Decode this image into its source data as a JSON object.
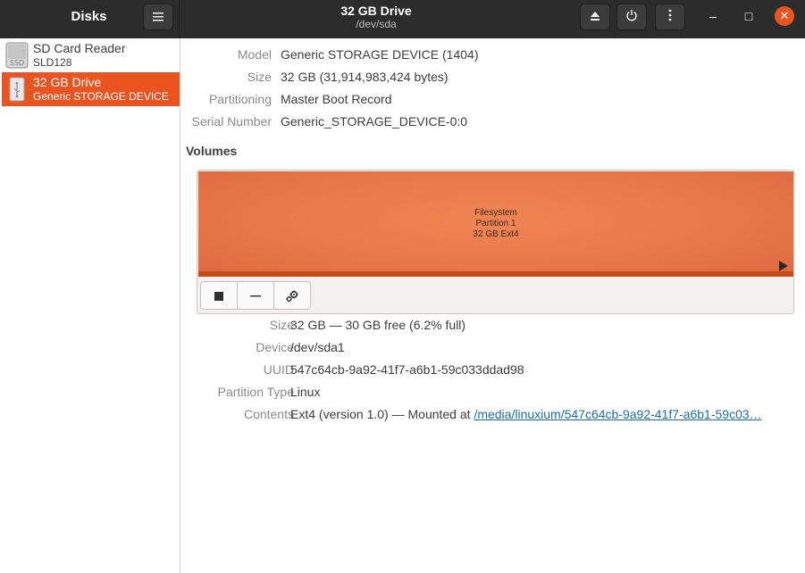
{
  "app": {
    "title": "Disks",
    "menu_icon": "hamburger-menu-icon"
  },
  "header": {
    "drive_title": "32 GB Drive",
    "drive_subtitle": "/dev/sda",
    "eject_icon": "eject-icon",
    "power_icon": "power-icon",
    "more_icon": "vertical-ellipsis-icon"
  },
  "window_controls": {
    "minimize": "–",
    "maximize": "□",
    "close": "✕"
  },
  "sidebar": {
    "items": [
      {
        "name": "SD Card Reader",
        "sub": "SLD128",
        "icon": "ssd-icon",
        "icon_label": "SSD",
        "selected": false
      },
      {
        "name": "32 GB Drive",
        "sub": "Generic STORAGE DEVICE",
        "icon": "usb-drive-icon",
        "selected": true
      }
    ]
  },
  "drive_info": {
    "model_label": "Model",
    "model_value": "Generic STORAGE DEVICE (1404)",
    "size_label": "Size",
    "size_value": "32 GB (31,914,983,424 bytes)",
    "partitioning_label": "Partitioning",
    "partitioning_value": "Master Boot Record",
    "serial_label": "Serial Number",
    "serial_value": "Generic_STORAGE_DEVICE-0:0"
  },
  "volumes": {
    "title": "Volumes",
    "partition": {
      "line1": "Filesystem",
      "line2": "Partition 1",
      "line3": "32 GB Ext4",
      "color": "#e8784a"
    },
    "toolbar": {
      "stop_icon": "stop-icon",
      "minus_icon": "minus-icon",
      "gears_icon": "gears-icon"
    }
  },
  "partition_info": {
    "size_label": "Size",
    "size_value": "32 GB — 30 GB free (6.2% full)",
    "device_label": "Device",
    "device_value": "/dev/sda1",
    "uuid_label": "UUID",
    "uuid_value": "547c64cb-9a92-41f7-a6b1-59c033ddad98",
    "ptype_label": "Partition Type",
    "ptype_value": "Linux",
    "contents_label": "Contents",
    "contents_prefix": "Ext4 (version 1.0) — Mounted at ",
    "contents_link": "/media/linuxium/547c64cb-9a92-41f7-a6b1-59c03…"
  },
  "colors": {
    "accent": "#e95420",
    "headerbar": "#2c2c2c"
  }
}
